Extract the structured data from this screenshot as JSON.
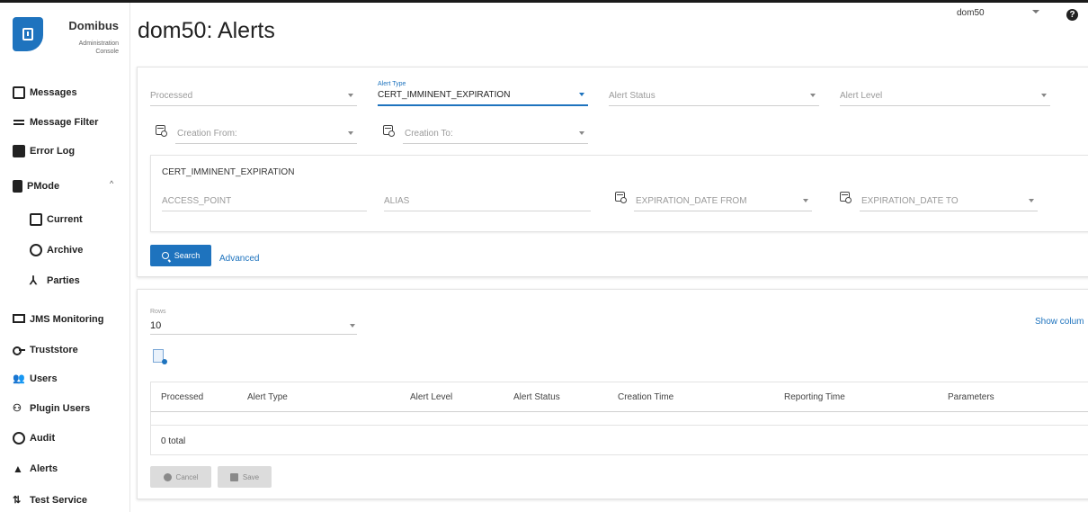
{
  "app": {
    "name": "Domibus",
    "subtitle_line1": "Administration",
    "subtitle_line2": "Console"
  },
  "header": {
    "title": "dom50: Alerts",
    "domain_value": "dom50",
    "help_glyph": "?"
  },
  "sidebar": {
    "items": [
      {
        "label": "Messages",
        "icon": "message-icon"
      },
      {
        "label": "Message Filter",
        "icon": "filter-icon"
      },
      {
        "label": "Error Log",
        "icon": "error-icon"
      },
      {
        "label": "PMode",
        "icon": "document-icon"
      },
      {
        "label": "Current",
        "icon": "list-icon"
      },
      {
        "label": "Archive",
        "icon": "history-icon"
      },
      {
        "label": "Parties",
        "icon": "parties-icon"
      },
      {
        "label": "JMS Monitoring",
        "icon": "monitor-icon"
      },
      {
        "label": "Truststore",
        "icon": "key-icon"
      },
      {
        "label": "Users",
        "icon": "users-icon"
      },
      {
        "label": "Plugin Users",
        "icon": "plugin-users-icon"
      },
      {
        "label": "Audit",
        "icon": "audit-icon"
      },
      {
        "label": "Alerts",
        "icon": "alert-icon"
      },
      {
        "label": "Test Service",
        "icon": "test-service-icon"
      }
    ]
  },
  "filter": {
    "processed_placeholder": "Processed",
    "alert_type_label": "Alert Type",
    "alert_type_value": "CERT_IMMINENT_EXPIRATION",
    "alert_status_placeholder": "Alert Status",
    "alert_level_placeholder": "Alert Level",
    "creation_from_placeholder": "Creation From:",
    "creation_to_placeholder": "Creation To:",
    "subpanel_title": "CERT_IMMINENT_EXPIRATION",
    "access_point_placeholder": "ACCESS_POINT",
    "alias_placeholder": "ALIAS",
    "expiration_from_placeholder": "EXPIRATION_DATE FROM",
    "expiration_to_placeholder": "EXPIRATION_DATE TO",
    "search_label": "Search",
    "advanced_label": "Advanced"
  },
  "grid": {
    "rows_label": "Rows",
    "rows_value": "10",
    "show_columns_label": "Show colum",
    "columns": [
      "Processed",
      "Alert Type",
      "Alert Level",
      "Alert Status",
      "Creation Time",
      "Reporting Time",
      "Parameters"
    ],
    "total_text": "0 total",
    "cancel_label": "Cancel",
    "save_label": "Save"
  },
  "colors": {
    "accent": "#1e73be",
    "disabled_button": "#dcdcdc"
  }
}
